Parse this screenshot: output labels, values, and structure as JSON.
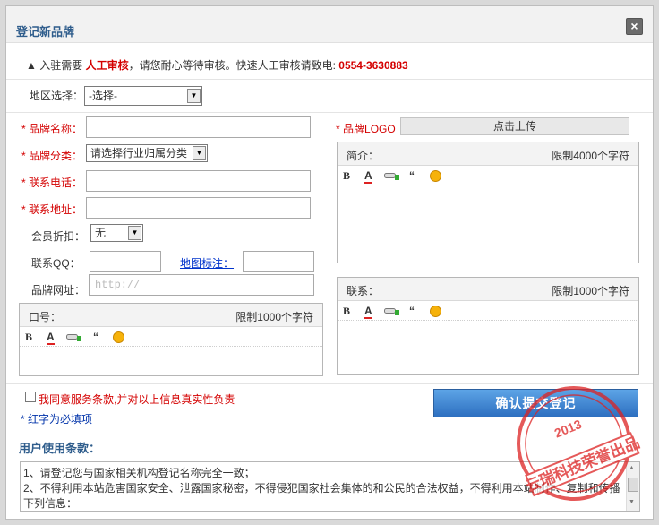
{
  "dialog": {
    "title": "登记新品牌",
    "close_label": "×"
  },
  "notice": {
    "arrow": "▲",
    "prefix": "入驻需要 ",
    "highlight": "人工审核",
    "middle": "，请您耐心等待审核。快速人工审核请致电: ",
    "phone": "0554-3630883"
  },
  "region": {
    "label": "地区选择：",
    "value": "-选择-"
  },
  "fields": {
    "brand_name": {
      "star": "* ",
      "label": "品牌名称："
    },
    "brand_category": {
      "star": "* ",
      "label": "品牌分类：",
      "value": "请选择行业归属分类"
    },
    "phone": {
      "star": "* ",
      "label": "联系电话："
    },
    "address": {
      "star": "* ",
      "label": "联系地址："
    },
    "discount": {
      "label": "会员折扣：",
      "value": "无"
    },
    "qq": {
      "label": "联系QQ："
    },
    "map": {
      "label": "地图标注："
    },
    "website": {
      "label": "品牌网址：",
      "placeholder": "http://"
    },
    "logo": {
      "star": "* ",
      "label": "品牌LOGO",
      "button": "点击上传"
    }
  },
  "editors": {
    "slogan": {
      "label": "口号：",
      "limit": "限制1000个字符"
    },
    "intro": {
      "label": "简介：",
      "limit": "限制4000个字符"
    },
    "contact": {
      "label": "联系：",
      "limit": "限制1000个字符"
    },
    "toolbar": {
      "bold": "B",
      "color": "A",
      "quote": "“"
    }
  },
  "agree": {
    "text": "我同意服务条款,并对以上信息真实性负责"
  },
  "required_note": "* 红字为必填项",
  "submit_label": "确认提交登记",
  "terms": {
    "title": "用户使用条款：",
    "lines": [
      "1、请登记您与国家相关机构登记名称完全一致；",
      "2、不得利用本站危害国家安全、泄露国家秘密，不得侵犯国家社会集体的和公民的合法权益，不得利用本站制作、复制和传播",
      "下列信息："
    ]
  },
  "watermark": {
    "text": "云瑞科技荣誉出品",
    "year": "2013"
  },
  "colors": {
    "required": "#d40000",
    "title": "#2f5d8c",
    "submit": "#2d6fc0",
    "link": "#0033cc"
  },
  "icons": [
    "close-icon",
    "bold-icon",
    "font-color-icon",
    "insert-link-icon",
    "quote-icon",
    "emoticon-icon",
    "dropdown-arrow-icon"
  ]
}
